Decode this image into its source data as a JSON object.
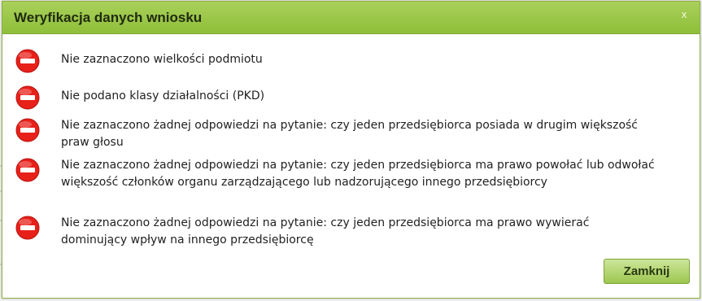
{
  "dialog": {
    "title": "Weryfikacja danych wniosku",
    "close_glyph": "x",
    "close_button_label": "Zamknij",
    "error_icon": "no-entry-icon",
    "error_color": "#e8201a",
    "accent_color": "#9ac94a",
    "messages": [
      "Nie zaznaczono wielkości podmiotu",
      "Nie podano klasy działalności (PKD)",
      "Nie zaznaczono żadnej odpowiedzi na pytanie: czy jeden przedsiębiorca posiada w drugim większość praw głosu",
      "Nie zaznaczono żadnej odpowiedzi na pytanie: czy jeden przedsiębiorca ma prawo powołać lub odwołać większość członków organu zarządzającego lub nadzorującego innego przedsiębiorcy",
      "Nie zaznaczono żadnej odpowiedzi na pytanie: czy jeden przedsiębiorca ma prawo wywierać dominujący wpływ na innego przedsiębiorcę"
    ]
  }
}
